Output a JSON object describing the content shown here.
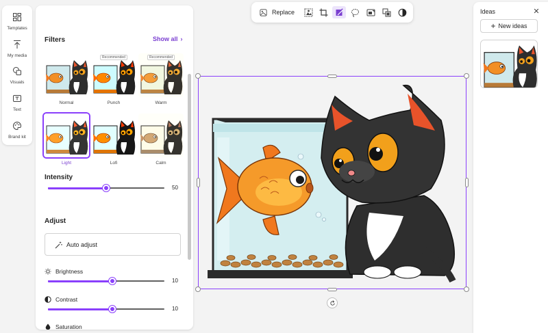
{
  "rail": {
    "items": [
      {
        "label": "Templates",
        "icon": "templates-icon"
      },
      {
        "label": "My media",
        "icon": "upload-icon"
      },
      {
        "label": "Visuals",
        "icon": "shapes-icon"
      },
      {
        "label": "Text",
        "icon": "text-icon"
      },
      {
        "label": "Brand kit",
        "icon": "palette-icon"
      }
    ]
  },
  "filters": {
    "title": "Filters",
    "show_all": "Show all",
    "recommended_badge": "Recommended",
    "items": [
      {
        "label": "Normal",
        "recommended": false,
        "selected": false
      },
      {
        "label": "Punch",
        "recommended": true,
        "selected": false
      },
      {
        "label": "Warm",
        "recommended": true,
        "selected": false
      },
      {
        "label": "Light",
        "recommended": false,
        "selected": true
      },
      {
        "label": "Lofi",
        "recommended": false,
        "selected": false
      },
      {
        "label": "Calm",
        "recommended": false,
        "selected": false
      }
    ]
  },
  "intensity": {
    "label": "Intensity",
    "value": "50",
    "fraction": 0.5
  },
  "adjust": {
    "title": "Adjust",
    "auto_adjust": "Auto adjust",
    "brightness": {
      "label": "Brightness",
      "value": "10",
      "fraction": 0.55
    },
    "contrast": {
      "label": "Contrast",
      "value": "10",
      "fraction": 0.55
    },
    "saturation": {
      "label": "Saturation"
    }
  },
  "toolbar": {
    "replace": "Replace",
    "icons": [
      "remove-background-icon",
      "crop-icon",
      "filters-icon",
      "lasso-select-icon",
      "blur-background-icon",
      "layers-icon",
      "adjust-contrast-icon"
    ],
    "active": "filters-icon"
  },
  "ideas": {
    "title": "Ideas",
    "new_ideas": "New ideas"
  },
  "colors": {
    "accent": "#8a3ffc",
    "accent_text": "#7b3fd1"
  }
}
